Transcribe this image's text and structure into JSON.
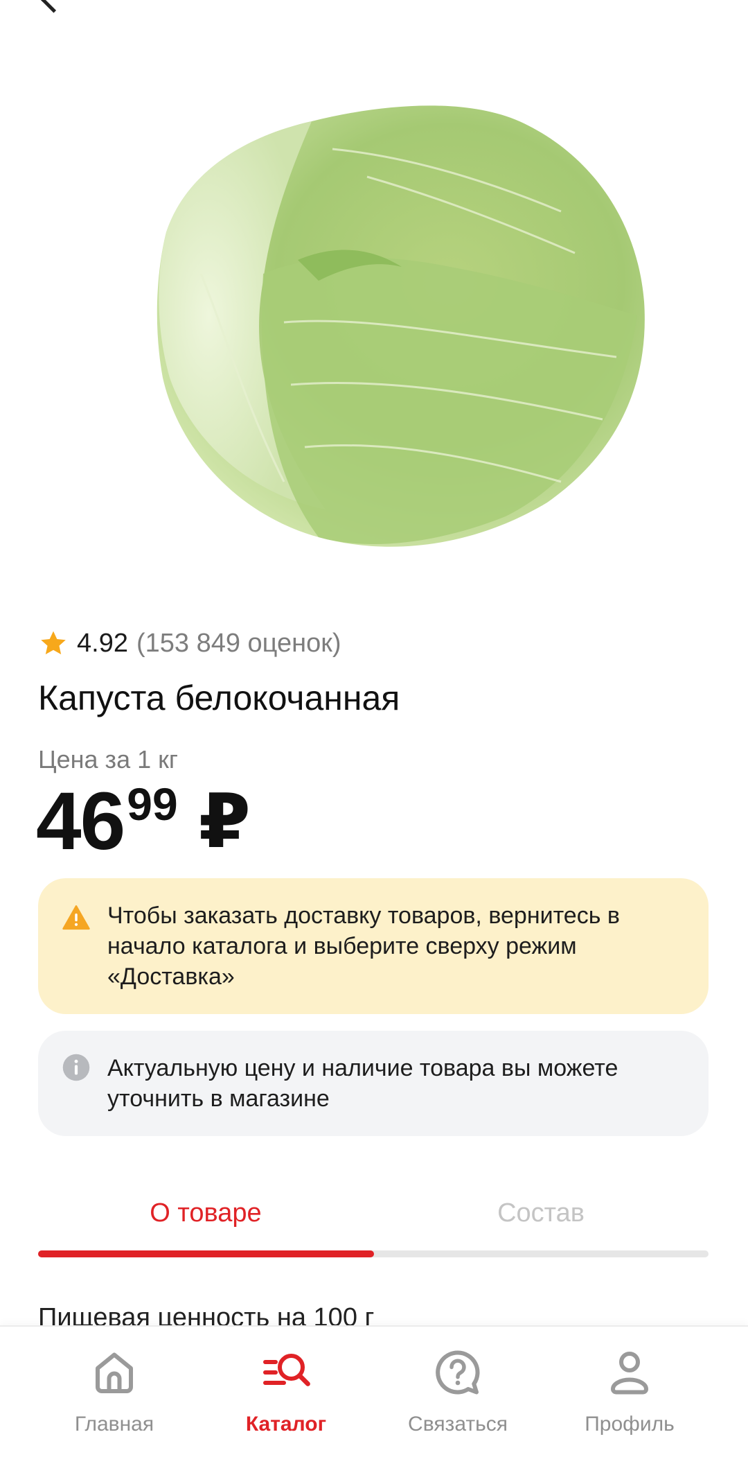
{
  "product": {
    "image_alt": "Капуста белокочанная",
    "rating_value": "4.92",
    "rating_count": "(153 849 оценок)",
    "title": "Капуста белокочанная",
    "price_label": "Цена за 1 кг",
    "price_rubles": "46",
    "price_kopecks": "99",
    "currency": "₽"
  },
  "notices": {
    "warning": "Чтобы заказать доставку товаров, вернитесь в начало каталога и выберите сверху режим «Доставка»",
    "info": "Актуальную цену и наличие товара вы можете уточнить в магазине"
  },
  "tabs": {
    "items": [
      {
        "label": "О товаре",
        "active": true
      },
      {
        "label": "Состав",
        "active": false
      }
    ]
  },
  "section": {
    "nutrition_title": "Пищевая ценность на 100 г"
  },
  "bottom_nav": {
    "items": [
      {
        "label": "Главная",
        "icon": "home-icon",
        "active": false
      },
      {
        "label": "Каталог",
        "icon": "catalog-search-icon",
        "active": true
      },
      {
        "label": "Связаться",
        "icon": "help-chat-icon",
        "active": false
      },
      {
        "label": "Профиль",
        "icon": "profile-icon",
        "active": false
      }
    ]
  },
  "colors": {
    "accent": "#e02226",
    "warning_bg": "#fdf1ca",
    "warning_icon": "#f5a623",
    "info_bg": "#f3f4f6",
    "star": "#f7a81b"
  }
}
